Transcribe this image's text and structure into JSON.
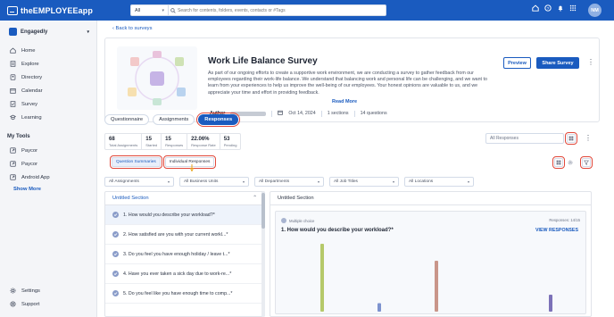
{
  "app": {
    "logo_text": "theEMPLOYEEapp"
  },
  "topbar": {
    "search_scope": "All",
    "search_placeholder": "Search for contents, folders, events, contacts or #Tags",
    "avatar_initials": "NM"
  },
  "sidebar": {
    "org_name": "Engagedly",
    "items": [
      {
        "label": "Home",
        "icon": "home-icon"
      },
      {
        "label": "Explore",
        "icon": "explore-icon"
      },
      {
        "label": "Directory",
        "icon": "directory-icon"
      },
      {
        "label": "Calendar",
        "icon": "calendar-icon"
      },
      {
        "label": "Survey",
        "icon": "survey-icon"
      },
      {
        "label": "Learning",
        "icon": "learning-icon"
      }
    ],
    "my_tools_label": "My Tools",
    "tools": [
      {
        "label": "Paycor",
        "icon": "link-icon"
      },
      {
        "label": "Paycor",
        "icon": "link-icon"
      },
      {
        "label": "Android App",
        "icon": "link-icon"
      }
    ],
    "show_more": "Show More",
    "bottom": [
      {
        "label": "Settings",
        "icon": "gear-icon"
      },
      {
        "label": "Support",
        "icon": "support-icon"
      }
    ]
  },
  "main": {
    "back_label": "Back to surveys",
    "survey": {
      "title": "Work Life Balance Survey",
      "description": "As part of our ongoing efforts to create a supportive work environment, we are conducting a survey to gather feedback from our employees regarding their work-life balance. We understand that balancing work and personal life can be challenging, and we want to learn from your experiences to help us improve the well-being of our employees. Your honest opinions are valuable to us, and we appreciate your time and effort in providing feedback.",
      "read_more": "Read More",
      "author_label": "Author",
      "date": "Oct 14, 2024",
      "sections": "1 sections",
      "questions": "14 questions"
    },
    "actions": {
      "preview": "Preview",
      "share": "Share Survey"
    },
    "tabs": [
      "Questionnaire",
      "Assignments",
      "Responses"
    ],
    "active_tab": "Responses",
    "stats": [
      {
        "value": "68",
        "label": "Total Assignments"
      },
      {
        "value": "15",
        "label": "Started"
      },
      {
        "value": "15",
        "label": "Responses"
      },
      {
        "value": "22.06%",
        "label": "Response Rate"
      },
      {
        "value": "53",
        "label": "Pending"
      }
    ],
    "responses_filter": "All Responses",
    "subtabs": [
      "Question Summaries",
      "Individual Responses"
    ],
    "filters": [
      "All Assignments",
      "All Business Units",
      "All Departments",
      "All Job Titles",
      "All Locations"
    ],
    "section_name": "Untitled Section",
    "question_list": [
      "1. How would you describe your workload?*",
      "2. How satisfied are you with your current workl...*",
      "3. Do you feel you have enough holiday / leave t...*",
      "4. Have you ever taken a sick day due to work-re...*",
      "5. Do you feel like you have enough time to comp...*"
    ],
    "detail": {
      "section_name": "Untitled Section",
      "question_type": "Multiple choice",
      "responses_count": "Responses: 14/15",
      "question_title": "1. How would you describe your workload?*",
      "view_responses": "VIEW RESPONSES"
    }
  },
  "chart_data": {
    "type": "bar",
    "categories": [
      "",
      "",
      "",
      "",
      ""
    ],
    "values": [
      8,
      1,
      6,
      0,
      2
    ],
    "colors": [
      "#b5c96a",
      "#7d93cf",
      "#c9968a",
      "#9aa3b8",
      "#7c72b8"
    ],
    "ylim": [
      0,
      8
    ]
  },
  "colors": {
    "brand": "#1a5bbf",
    "highlight": "#e1483a"
  }
}
